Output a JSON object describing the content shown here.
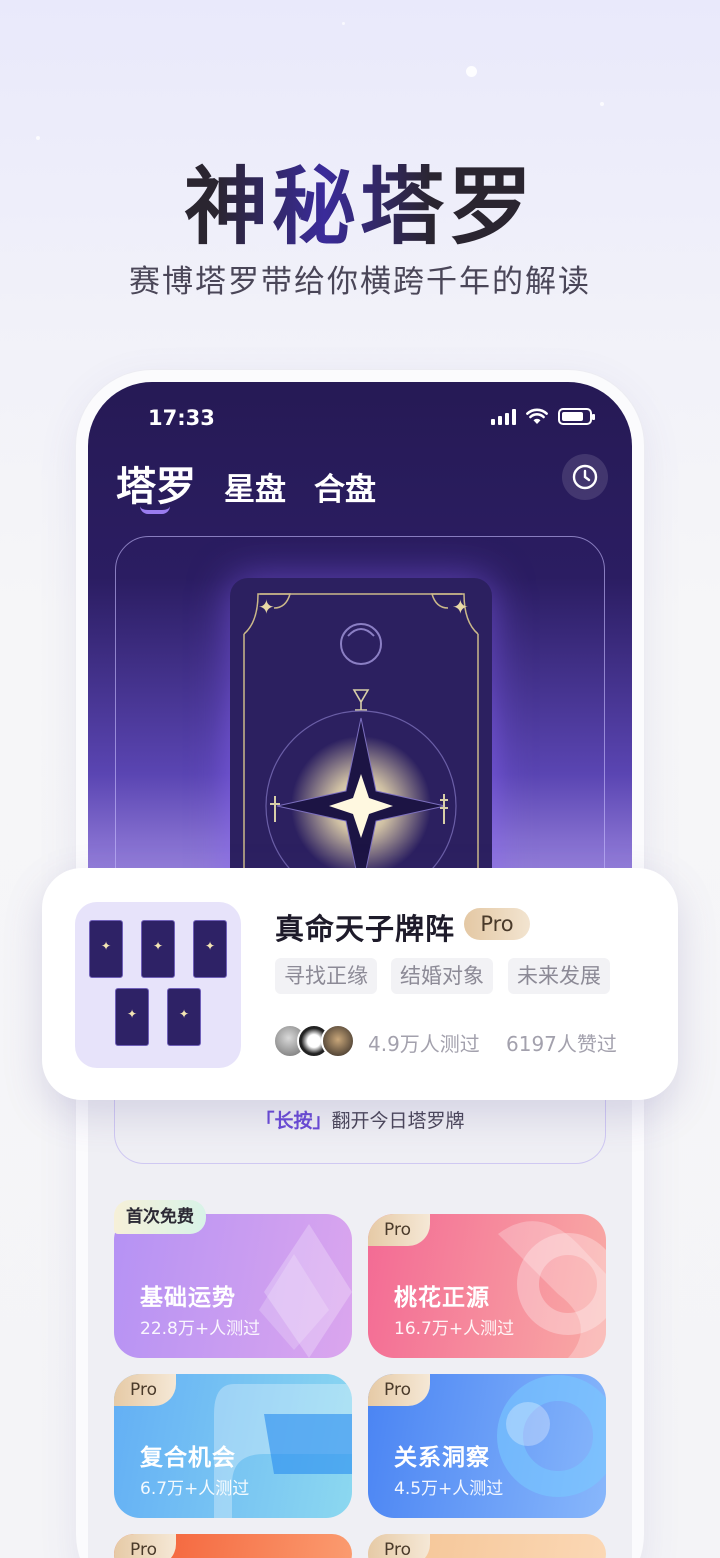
{
  "hero": {
    "title": "神秘塔罗",
    "subtitle": "赛博塔罗带给你横跨千年的解读"
  },
  "phone": {
    "status_time": "17:33",
    "tabs": [
      {
        "label": "塔罗",
        "active": true
      },
      {
        "label": "星盘",
        "active": false
      },
      {
        "label": "合盘",
        "active": false
      }
    ],
    "history_icon": "clock-icon"
  },
  "featured": {
    "title": "真命天子牌阵",
    "badge": "Pro",
    "tags": [
      "寻找正缘",
      "结婚对象",
      "未来发展"
    ],
    "tested": "4.9万人测过",
    "liked": "6197人赞过"
  },
  "hint": {
    "highlight": "「长按」",
    "text": "翻开今日塔罗牌"
  },
  "tiles": [
    {
      "title": "基础运势",
      "count": "22.8万+人测过",
      "badge": "首次免费",
      "color_from": "#b99af6",
      "color_to": "#d6a7f2"
    },
    {
      "title": "桃花正源",
      "count": "16.7万+人测过",
      "badge": "Pro",
      "color_from": "#f46f96",
      "color_to": "#f9a6a0"
    },
    {
      "title": "复合机会",
      "count": "6.7万+人测过",
      "badge": "Pro",
      "color_from": "#5fb0f6",
      "color_to": "#8fd9f2"
    },
    {
      "title": "关系洞察",
      "count": "4.5万+人测过",
      "badge": "Pro",
      "color_from": "#4c86f4",
      "color_to": "#86b6fb"
    },
    {
      "title": "",
      "count": "",
      "badge": "Pro",
      "color_from": "#f4663a",
      "color_to": "#fb9a6c"
    },
    {
      "title": "",
      "count": "",
      "badge": "Pro",
      "color_from": "#f6c79a",
      "color_to": "#fbd9b6"
    }
  ]
}
